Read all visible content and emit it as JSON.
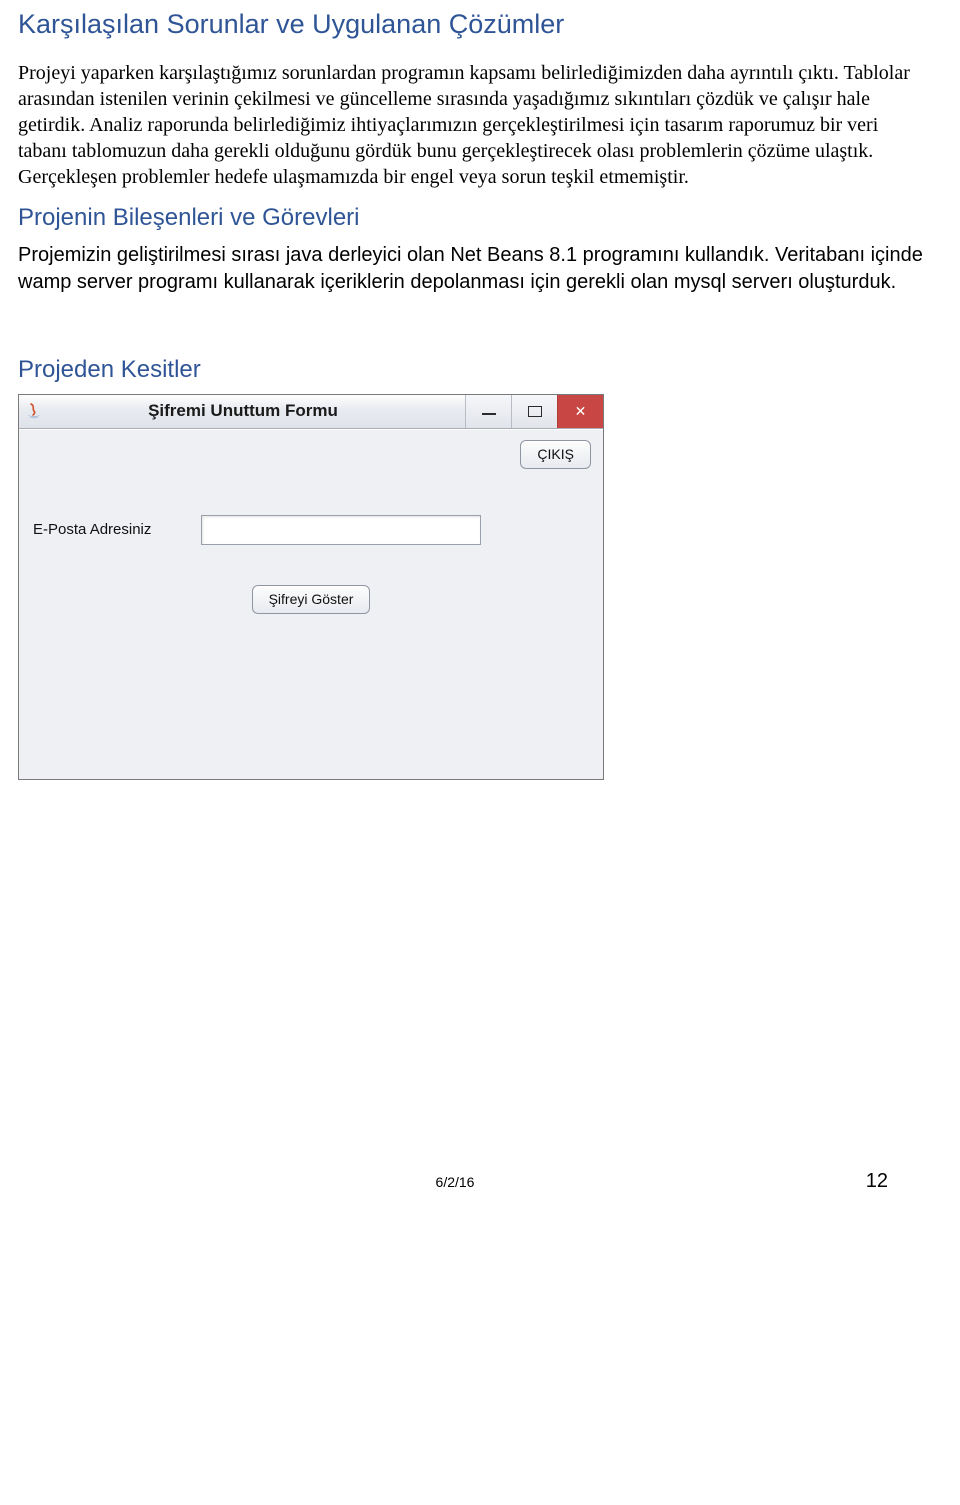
{
  "headings": {
    "h1": "Karşılaşılan Sorunlar ve Uygulanan Çözümler",
    "h2": "Projenin Bileşenleri ve Görevleri",
    "h3": "Projeden Kesitler"
  },
  "paragraphs": {
    "p1": "Projeyi yaparken karşılaştığımız sorunlardan programın kapsamı belirlediğimizden daha ayrıntılı çıktı. Tablolar arasından istenilen verinin çekilmesi ve güncelleme sırasında yaşadığımız sıkıntıları çözdük ve çalışır hale getirdik. Analiz raporunda belirlediğimiz ihtiyaçlarımızın gerçekleştirilmesi için tasarım raporumuz bir veri tabanı tablomuzun daha gerekli olduğunu gördük bunu gerçekleştirecek olası problemlerin çözüme ulaştık. Gerçekleşen problemler hedefe ulaşmamızda bir engel veya sorun teşkil etmemiştir.",
    "p2": "Projemizin geliştirilmesi sırası java derleyici olan Net Beans 8.1 programını kullandık. Veritabanı içinde wamp server programı kullanarak içeriklerin depolanması için gerekli olan mysql serverı oluşturduk."
  },
  "window": {
    "title": "Şifremi Unuttum Formu",
    "exit_label": "ÇIKIŞ",
    "email_label": "E-Posta Adresiniz",
    "show_label": "Şifreyi Göster",
    "email_value": ""
  },
  "footer": {
    "date": "6/2/16",
    "page": "12"
  }
}
